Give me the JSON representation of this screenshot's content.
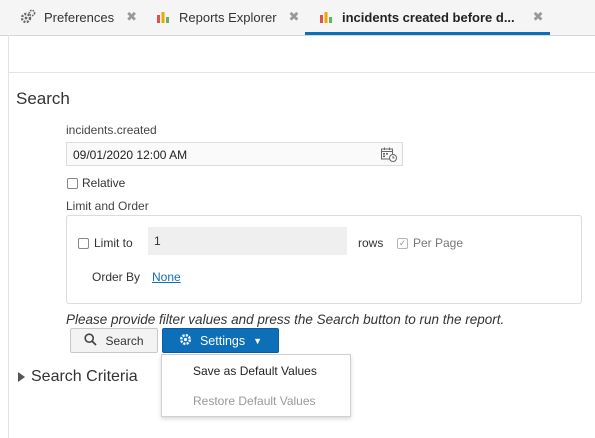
{
  "tabs": [
    {
      "label": "Preferences",
      "icon": "gear-icon"
    },
    {
      "label": "Reports Explorer",
      "icon": "bar-chart-icon"
    },
    {
      "label": "incidents created before d...",
      "icon": "bar-chart-icon",
      "active": true
    }
  ],
  "close_glyph": "✖",
  "search": {
    "heading": "Search",
    "field_label": "incidents.created",
    "date_value": "09/01/2020 12:00 AM",
    "relative_label": "Relative",
    "limit_heading": "Limit and Order",
    "limit_label": "Limit to",
    "limit_value": "1",
    "rows_label": "rows",
    "per_page_label": "Per Page",
    "per_page_checked": true,
    "order_by_label": "Order By",
    "order_by_value": "None",
    "hint": "Please provide filter values and press the Search button to run the report."
  },
  "buttons": {
    "search": "Search",
    "settings": "Settings"
  },
  "settings_menu": [
    {
      "label": "Save as Default Values",
      "enabled": true
    },
    {
      "label": "Restore Default Values",
      "enabled": false
    }
  ],
  "criteria_label": "Search Criteria",
  "colors": {
    "accent": "#0d6fb8",
    "chart_red": "#d9534f",
    "chart_orange": "#f0a500",
    "chart_green": "#5cb85c"
  }
}
